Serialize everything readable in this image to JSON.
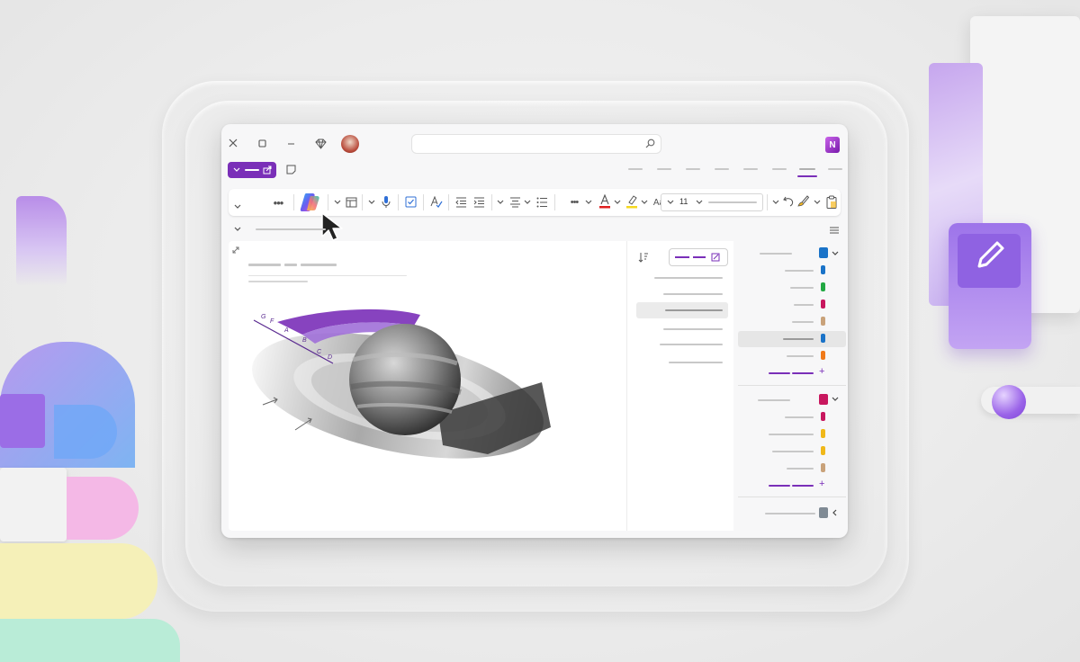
{
  "colors": {
    "accent": "#7a2fb8",
    "onenote": "#7719aa"
  },
  "toolbar": {
    "font_size": "11",
    "copilot_icon": "copilot-icon",
    "items": [
      "chevron-down-icon",
      "more-icon",
      "copilot-icon",
      "page-icon",
      "microphone-icon",
      "checkbox-icon",
      "spellcheck-icon",
      "outdent-icon",
      "indent-icon",
      "align-icon",
      "list-icon",
      "font-color-icon",
      "highlight-icon",
      "text-case-icon",
      "undo-icon",
      "format-painter-icon",
      "paste-icon"
    ]
  },
  "canvas": {
    "ring_labels": [
      "G",
      "F",
      "A",
      "B",
      "C",
      "D"
    ]
  },
  "sidebar": {
    "notebook1_sections": [
      {
        "color": "#1a73c8"
      },
      {
        "color": "#22a843"
      },
      {
        "color": "#c8175e"
      },
      {
        "color": "#c9a27a"
      },
      {
        "color": "#1a73c8"
      },
      {
        "color": "#f07a1a"
      }
    ],
    "notebook2_sections": [
      {
        "color": "#c8175e"
      },
      {
        "color": "#f0b81a"
      },
      {
        "color": "#f0b81a"
      },
      {
        "color": "#c9a27a"
      }
    ],
    "add_symbol": "+"
  }
}
